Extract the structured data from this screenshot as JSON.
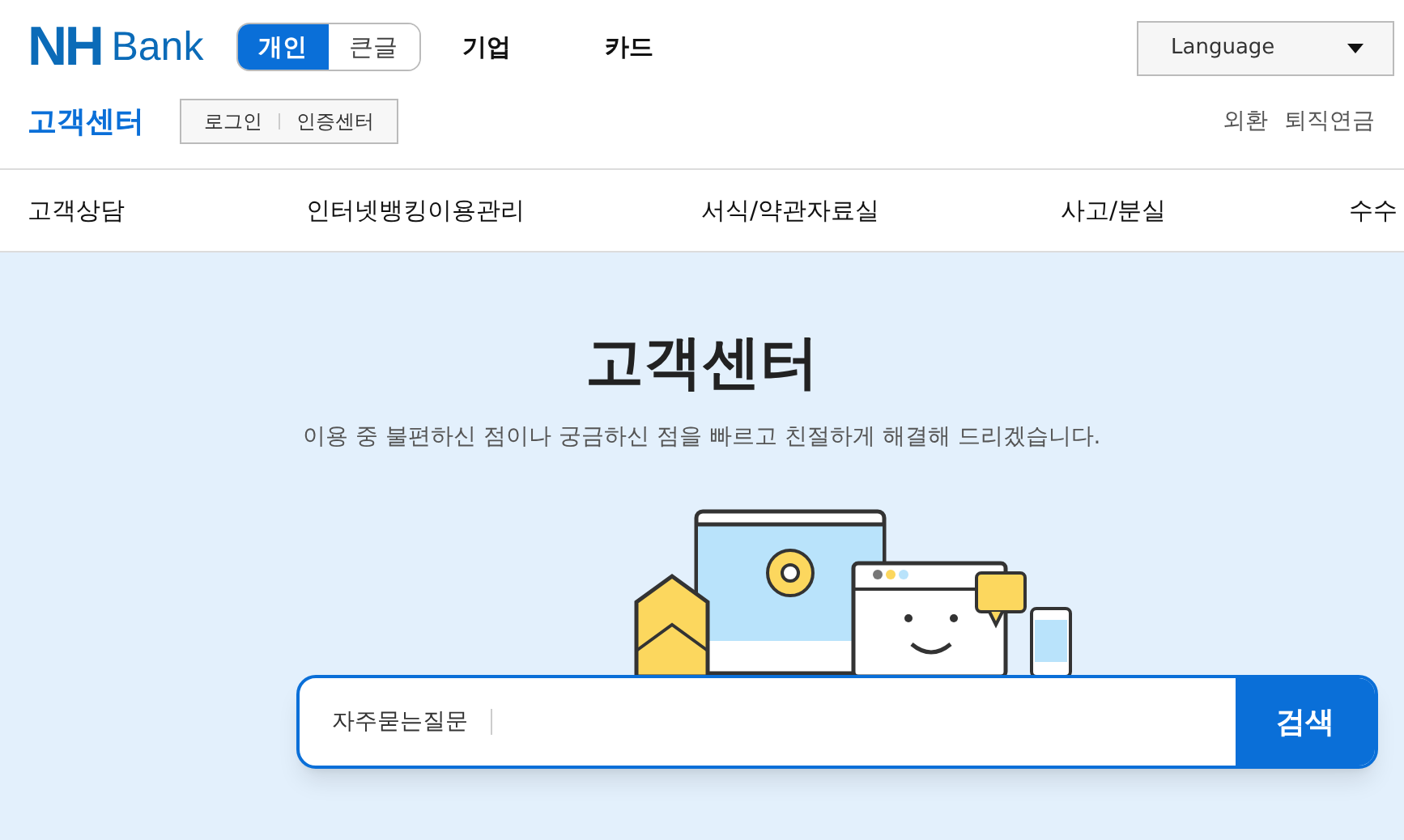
{
  "header": {
    "logo": {
      "mark": "NH",
      "word": "Bank"
    },
    "segments": [
      {
        "label": "개인",
        "selected": true
      },
      {
        "label": "큰글",
        "selected": false
      }
    ],
    "links": [
      "기업",
      "카드"
    ],
    "language": {
      "label": "Language"
    },
    "section_title": "고객센터",
    "auth_buttons": [
      "로그인",
      "인증센터"
    ],
    "utility_links": [
      "외환",
      "퇴직연금"
    ]
  },
  "nav": {
    "items": [
      "고객상담",
      "인터넷뱅킹이용관리",
      "서식/약관자료실",
      "사고/분실",
      "수수"
    ]
  },
  "hero": {
    "title": "고객센터",
    "subtitle": "이용 중 불편하신 점이나 궁금하신 점을 빠르고 친절하게 해결해 드리겠습니다.",
    "search": {
      "category": "자주묻는질문",
      "button": "검색"
    }
  }
}
